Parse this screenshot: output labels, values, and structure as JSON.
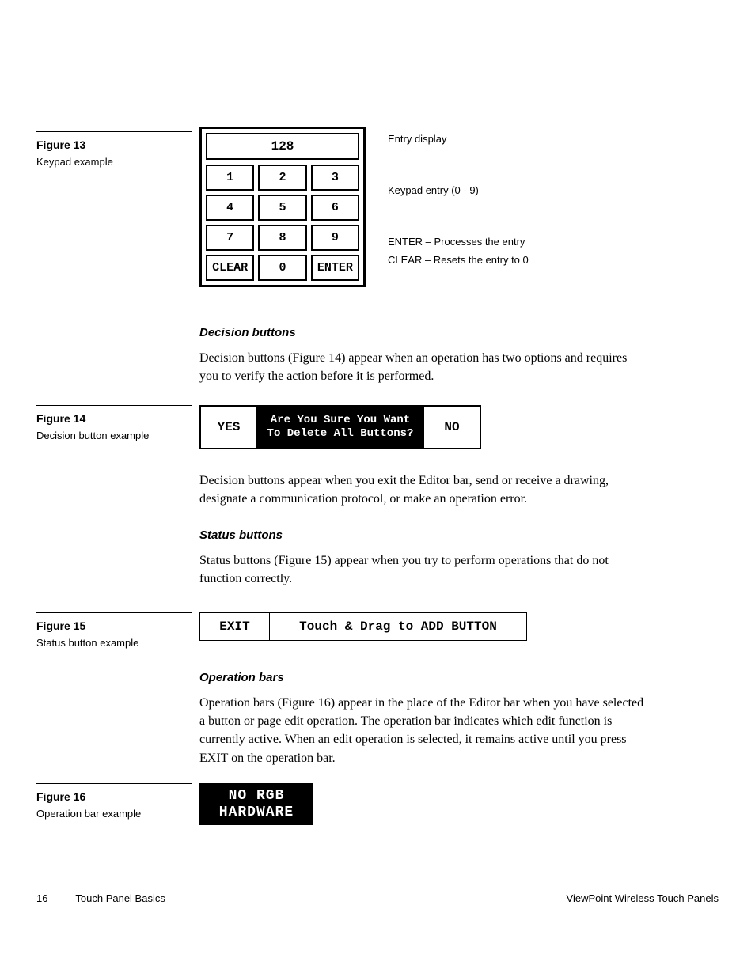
{
  "figures": {
    "f13": {
      "num": "Figure 13",
      "cap": "Keypad example"
    },
    "f14": {
      "num": "Figure 14",
      "cap": "Decision button example"
    },
    "f15": {
      "num": "Figure 15",
      "cap": "Status button example"
    },
    "f16": {
      "num": "Figure 16",
      "cap": "Operation bar example"
    }
  },
  "keypad": {
    "display": "128",
    "rows": [
      [
        "1",
        "2",
        "3"
      ],
      [
        "4",
        "5",
        "6"
      ],
      [
        "7",
        "8",
        "9"
      ],
      [
        "CLEAR",
        "0",
        "ENTER"
      ]
    ],
    "annot": {
      "entry": "Entry display",
      "pad": "Keypad entry (0 - 9)",
      "enter": "ENTER – Processes the entry",
      "clear": "CLEAR – Resets the entry to 0"
    }
  },
  "sections": {
    "decision": {
      "title": "Decision buttons",
      "p1": "Decision buttons (Figure 14) appear when an operation has two options and requires you to verify the action before it is performed.",
      "p2": "Decision buttons appear when you exit the Editor bar, send or receive a drawing, designate a communication protocol, or make an operation error."
    },
    "status": {
      "title": "Status buttons",
      "p1": "Status buttons (Figure 15) appear when you try to perform operations that do not function correctly."
    },
    "opbars": {
      "title": "Operation bars",
      "p1": "Operation bars (Figure 16) appear in the place of the Editor bar when you have selected a button or page edit operation. The operation bar indicates which edit function is currently active. When an edit operation is selected, it remains active until you press EXIT on the operation bar."
    }
  },
  "decision_fig": {
    "yes": "YES",
    "msg": "Are You Sure You Want\nTo Delete All Buttons?",
    "no": "NO"
  },
  "status_fig": {
    "exit": "EXIT",
    "msg": "Touch & Drag to ADD BUTTON"
  },
  "opbar_fig": {
    "msg": "NO RGB\nHARDWARE"
  },
  "footer": {
    "page": "16",
    "left": "Touch Panel Basics",
    "right": "ViewPoint Wireless Touch Panels"
  }
}
